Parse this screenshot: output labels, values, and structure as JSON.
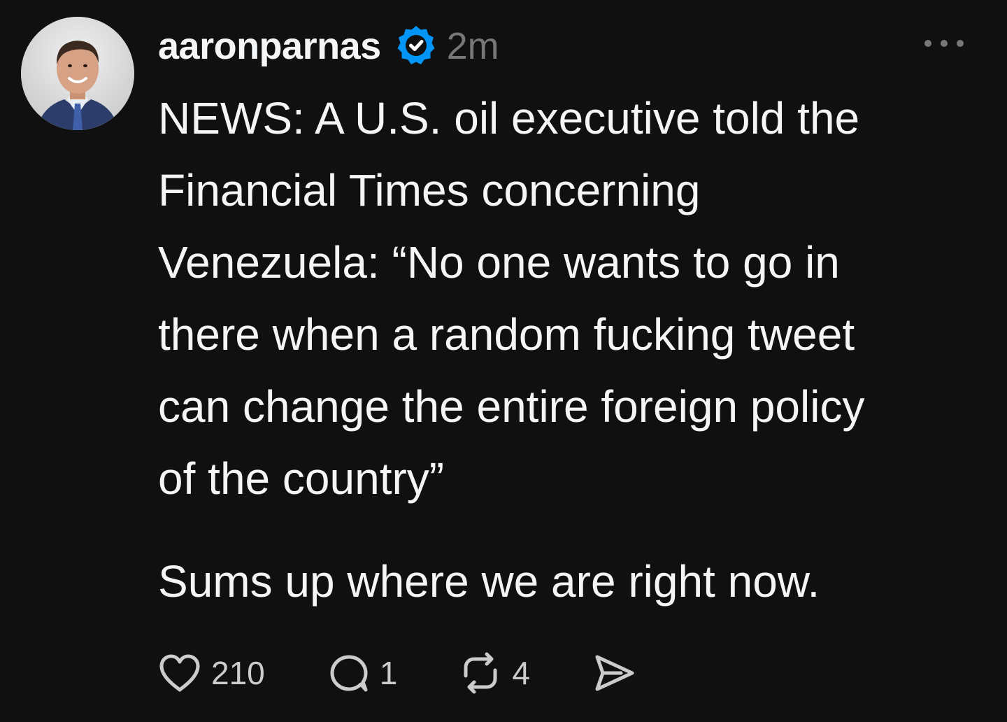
{
  "post": {
    "username": "aaronparnas",
    "timestamp": "2m",
    "body_paragraph_1": "NEWS: A U.S. oil executive told the\nFinancial Times concerning\nVenezuela: “No one wants to go in\nthere when a random fucking tweet\ncan change the entire foreign policy\nof the country”",
    "body_paragraph_2": "Sums up where we are right now.",
    "likes": "210",
    "replies": "1",
    "reposts": "4"
  },
  "icons": {
    "verified": "verified-badge-icon",
    "more": "more-options-icon",
    "like": "heart-icon",
    "reply": "comment-icon",
    "repost": "repost-icon",
    "share": "send-icon"
  },
  "colors": {
    "background": "#101010",
    "text": "#f3f5f7",
    "muted": "#777777",
    "verified": "#0095f6"
  }
}
